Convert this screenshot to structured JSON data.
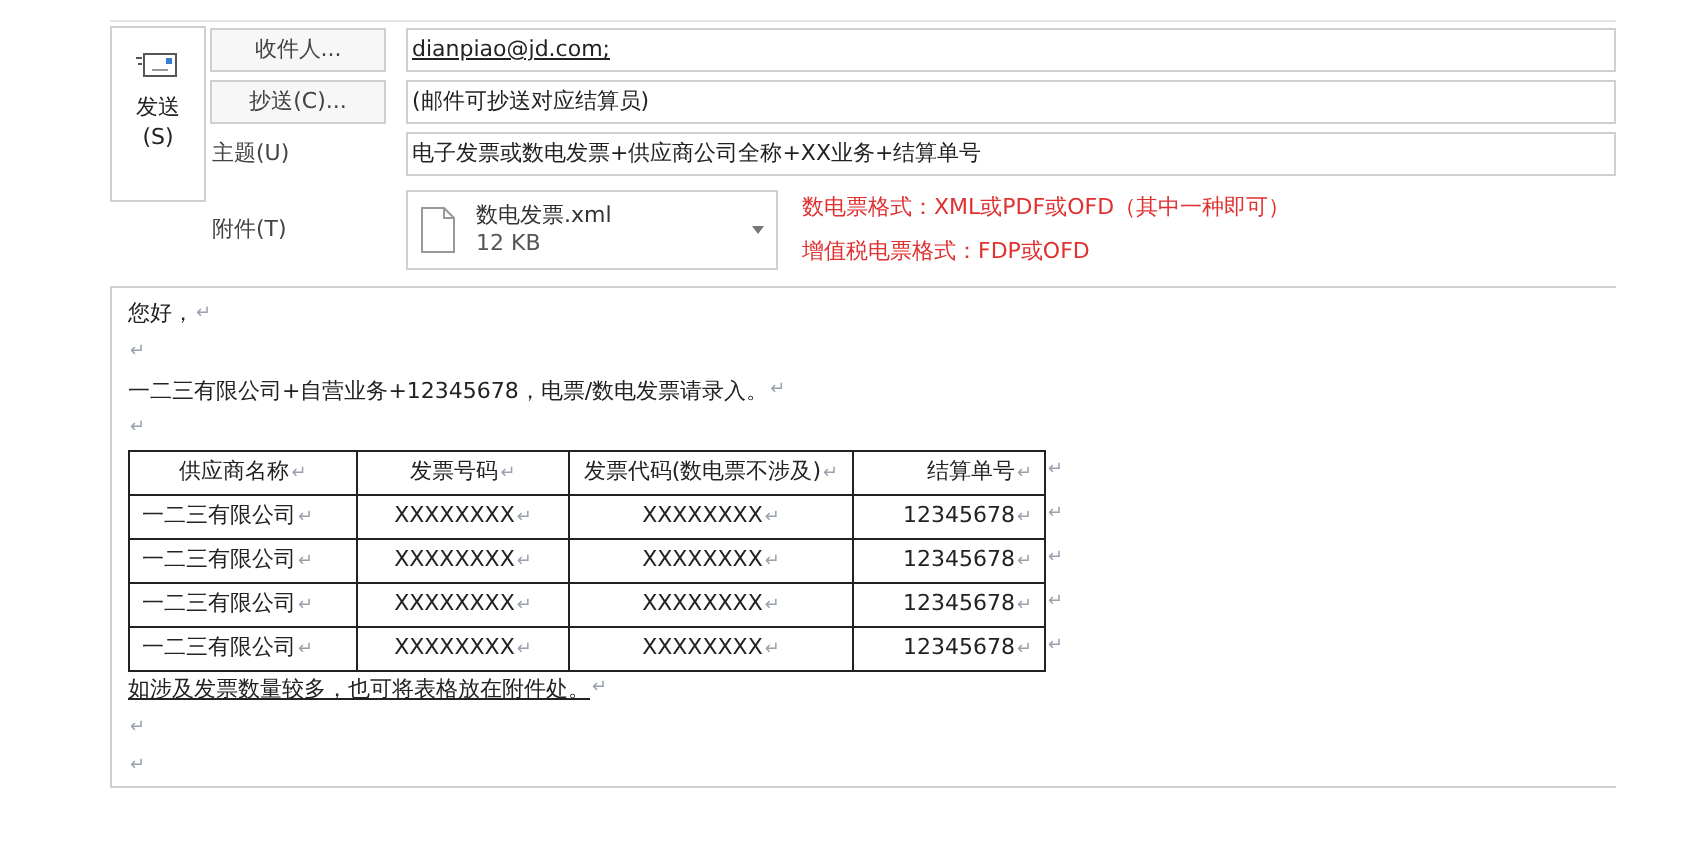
{
  "send_button": {
    "label": "发送",
    "shortcut": "(S)"
  },
  "fields": [
    {
      "kind": "button",
      "label": "收件人...",
      "value": "dianpiao@jd.com;",
      "underline": true
    },
    {
      "kind": "button",
      "label": "抄送(C)...",
      "value": "(邮件可抄送对应结算员)",
      "underline": false
    },
    {
      "kind": "plain",
      "label": "主题(U)",
      "value": "电子发票或数电发票+供应商公司全称+XX业务+结算单号",
      "underline": false
    }
  ],
  "attachment": {
    "label": "附件(T)",
    "file_name": "数电发票.xml",
    "file_size": "12 KB",
    "notes": [
      "数电票格式：XML或PDF或OFD（其中一种即可）",
      "增值税电票格式：FDP或OFD"
    ]
  },
  "body": {
    "before": [
      {
        "text": "您好，",
        "mark": "↵"
      },
      {
        "mark": "↵"
      },
      {
        "text": "一二三有限公司+自营业务+12345678，电票/数电发票请录入。",
        "mark": "↵"
      },
      {
        "mark": "↵"
      }
    ],
    "table": {
      "columns": [
        "供应商名称",
        "发票号码",
        "发票代码(数电票不涉及)",
        "结算单号"
      ],
      "rows": [
        [
          "一二三有限公司",
          "XXXXXXXX",
          "XXXXXXXX",
          "12345678"
        ],
        [
          "一二三有限公司",
          "XXXXXXXX",
          "XXXXXXXX",
          "12345678"
        ],
        [
          "一二三有限公司",
          "XXXXXXXX",
          "XXXXXXXX",
          "12345678"
        ],
        [
          "一二三有限公司",
          "XXXXXXXX",
          "XXXXXXXX",
          "12345678"
        ]
      ],
      "mark": "↵"
    },
    "after": [
      {
        "text": "如涉及发票数量较多，也可将表格放在附件处。",
        "mark": "↵",
        "underline": true
      },
      {
        "mark": "↵"
      },
      {
        "mark": "↵"
      }
    ]
  }
}
